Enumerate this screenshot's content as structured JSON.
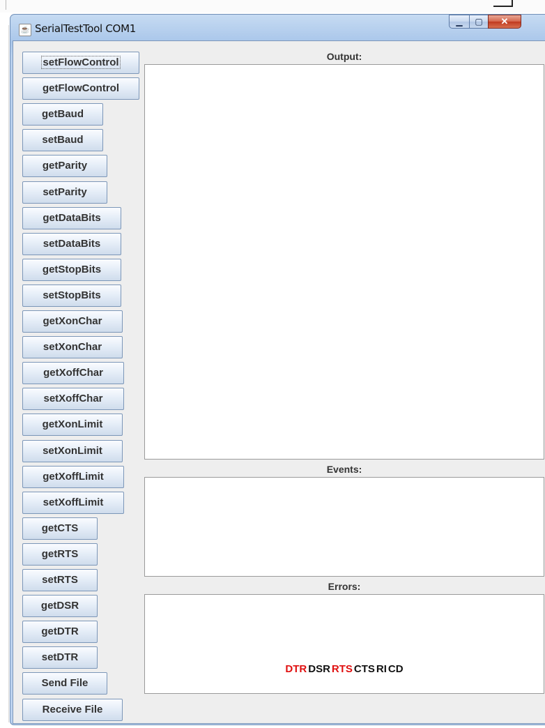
{
  "window": {
    "title": "SerialTestTool COM1"
  },
  "buttons": [
    {
      "label": "setFlowControl"
    },
    {
      "label": "getFlowControl"
    },
    {
      "label": "getBaud"
    },
    {
      "label": "setBaud"
    },
    {
      "label": "getParity"
    },
    {
      "label": "setParity"
    },
    {
      "label": "getDataBits"
    },
    {
      "label": "setDataBits"
    },
    {
      "label": "getStopBits"
    },
    {
      "label": "setStopBits"
    },
    {
      "label": "getXonChar"
    },
    {
      "label": "setXonChar"
    },
    {
      "label": "getXoffChar"
    },
    {
      "label": "setXoffChar"
    },
    {
      "label": "getXonLimit"
    },
    {
      "label": "setXonLimit"
    },
    {
      "label": "getXoffLimit"
    },
    {
      "label": "setXoffLimit"
    },
    {
      "label": "getCTS"
    },
    {
      "label": "getRTS"
    },
    {
      "label": "setRTS"
    },
    {
      "label": "getDSR"
    },
    {
      "label": "getDTR"
    },
    {
      "label": "setDTR"
    },
    {
      "label": "Send File"
    },
    {
      "label": "Receive File"
    }
  ],
  "panels": {
    "output_label": "Output:",
    "events_label": "Events:",
    "errors_label": "Errors:"
  },
  "status": {
    "signals": [
      {
        "label": "DTR",
        "color": "#e01010"
      },
      {
        "label": "DSR",
        "color": "#111111"
      },
      {
        "label": "RTS",
        "color": "#e01010"
      },
      {
        "label": "CTS",
        "color": "#111111"
      },
      {
        "label": "RI",
        "color": "#111111"
      },
      {
        "label": "CD",
        "color": "#111111"
      }
    ]
  },
  "icons": {
    "app_icon": "java-cup-icon",
    "minimize": "minimize-icon",
    "maximize": "maximize-icon",
    "close": "close-icon"
  }
}
